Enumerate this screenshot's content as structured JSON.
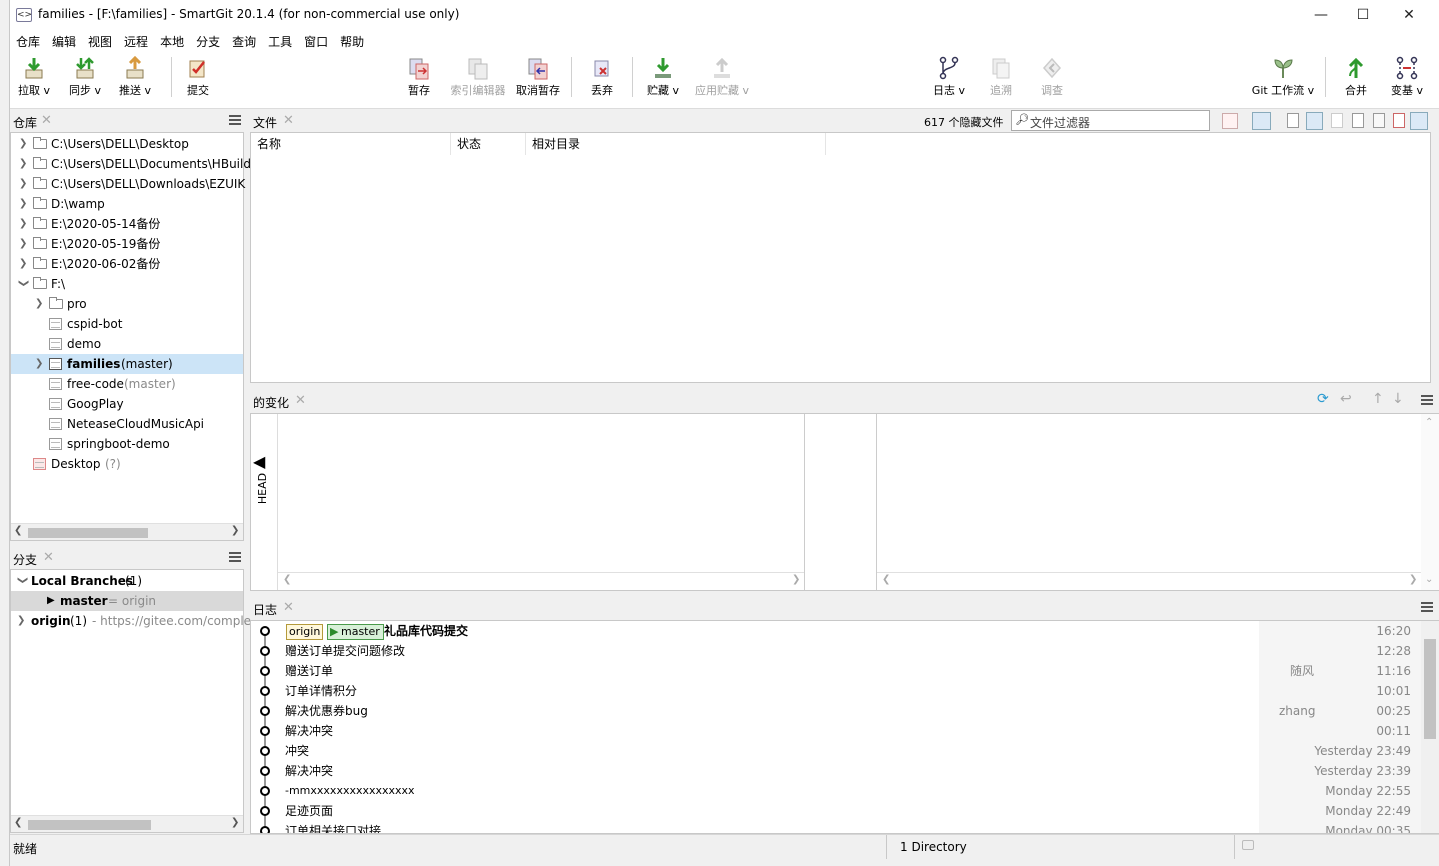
{
  "window": {
    "title": "families - [F:\\families] - SmartGit 20.1.4 (for non-commercial use only)",
    "minimize": "—",
    "maximize": "☐",
    "close": "✕"
  },
  "menu": [
    "仓库",
    "编辑",
    "视图",
    "远程",
    "本地",
    "分支",
    "查询",
    "工具",
    "窗口",
    "帮助"
  ],
  "toolbar": {
    "pull": "拉取 v",
    "sync": "同步 v",
    "push": "推送 v",
    "commit": "提交",
    "stage": "暂存",
    "index_editor": "索引编辑器",
    "unstage": "取消暂存",
    "discard": "丢弃",
    "stash": "贮藏 v",
    "apply_stash": "应用贮藏 v",
    "log": "日志 v",
    "blame": "追溯",
    "investigate": "调查",
    "git_flow": "Git 工作流 v",
    "merge": "合并",
    "rebase": "变基 v"
  },
  "repos_panel": {
    "title": "仓库",
    "items": [
      {
        "label": "C:\\Users\\DELL\\Desktop",
        "extra": ""
      },
      {
        "label": "C:\\Users\\DELL\\Documents\\HBuild",
        "extra": ""
      },
      {
        "label": "C:\\Users\\DELL\\Downloads\\EZUIK",
        "extra": ""
      },
      {
        "label": "D:\\wamp",
        "extra": ""
      },
      {
        "label": "E:\\2020-05-14备份",
        "extra": ""
      },
      {
        "label": "E:\\2020-05-19备份",
        "extra": ""
      },
      {
        "label": "E:\\2020-06-02备份",
        "extra": ""
      },
      {
        "label": "F:\\",
        "extra": ""
      },
      {
        "label": "pro",
        "extra": ""
      },
      {
        "label": "cspid-bot",
        "extra": ""
      },
      {
        "label": "demo",
        "extra": ""
      },
      {
        "label": "families",
        "extra": "(master)"
      },
      {
        "label": "free-code",
        "extra": "(master)"
      },
      {
        "label": "GoogPlay",
        "extra": ""
      },
      {
        "label": "NeteaseCloudMusicApi",
        "extra": ""
      },
      {
        "label": "springboot-demo",
        "extra": ""
      },
      {
        "label": "Desktop",
        "extra": "(?)"
      }
    ]
  },
  "branches_panel": {
    "title": "分支",
    "local_label": "Local Branches",
    "local_count": "(1)",
    "master_label": "master",
    "master_tracking": "= origin",
    "origin_label": "origin",
    "origin_count": "(1)",
    "origin_url": "- https://gitee.com/comple"
  },
  "files_panel": {
    "title": "文件",
    "hidden_count": "617 个隐藏文件",
    "filter_placeholder": "文件过滤器",
    "columns": [
      "名称",
      "状态",
      "相对目录"
    ]
  },
  "changes_panel": {
    "title": "的变化",
    "head_label": "HEAD"
  },
  "log_panel": {
    "title": "日志",
    "tag_origin": "origin",
    "tag_master": "master",
    "commits": [
      {
        "message": "礼品库代码提交",
        "author": "",
        "date": "16:20"
      },
      {
        "message": "赠送订单提交问题修改",
        "author": "",
        "date": "12:28"
      },
      {
        "message": "赠送订单",
        "author": "随风",
        "date": "11:16"
      },
      {
        "message": "订单详情积分",
        "author": "",
        "date": "10:01"
      },
      {
        "message": "解决优惠券bug",
        "author": "zhang",
        "date": "00:25"
      },
      {
        "message": "解决冲突",
        "author": "",
        "date": "00:11"
      },
      {
        "message": "冲突",
        "author": "",
        "date": "Yesterday 23:49"
      },
      {
        "message": "解决冲突",
        "author": "",
        "date": "Yesterday 23:39"
      },
      {
        "message": "-mmxxxxxxxxxxxxxxxx",
        "author": "",
        "date": "Monday 22:55"
      },
      {
        "message": "足迹页面",
        "author": "",
        "date": "Monday 22:49"
      },
      {
        "message": "订单相关接口对接",
        "author": "",
        "date": "Monday 00:35"
      }
    ]
  },
  "status": {
    "left": "就绪",
    "directory": "1 Directory"
  }
}
